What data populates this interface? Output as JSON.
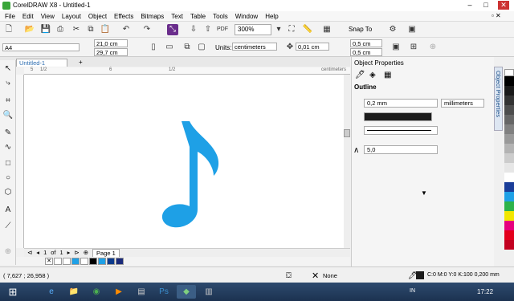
{
  "window": {
    "title": "CorelDRAW X8 - Untitled-1"
  },
  "menu": [
    "File",
    "Edit",
    "View",
    "Layout",
    "Object",
    "Effects",
    "Bitmaps",
    "Text",
    "Table",
    "Tools",
    "Window",
    "Help"
  ],
  "toolbar": {
    "zoom": "300%",
    "snap_label": "Snap To"
  },
  "propbar": {
    "page_size": "A4",
    "width": "21,0 cm",
    "height": "29,7 cm",
    "units_label": "Units:",
    "units_value": "centimeters",
    "nudge": "0,01 cm",
    "dup_x": "0,5 cm",
    "dup_y": "0,5 cm"
  },
  "doc_tab": "Untitled-1",
  "ruler": {
    "units": "centimeters",
    "ticks": [
      "5",
      "1/2",
      "6",
      "1/2"
    ]
  },
  "pagenav": {
    "current": "1",
    "of": "of",
    "total": "1",
    "page_tab": "Page 1"
  },
  "panel": {
    "title": "Object Properties",
    "section": "Outline",
    "width": "0,2 mm",
    "width_units": "millimeters",
    "miter": "5,0",
    "dock_tab": "Object Properties"
  },
  "status": {
    "coords": "( 7,627 ; 26,958 )",
    "fill_label": "None",
    "outline_info": "C:0 M:0 Y:0 K:100  0,200 mm"
  },
  "taskbar": {
    "lang": "IN",
    "time": "17:22"
  },
  "colors": {
    "note": "#1ea0e6",
    "accent": "#1b6fb8"
  }
}
